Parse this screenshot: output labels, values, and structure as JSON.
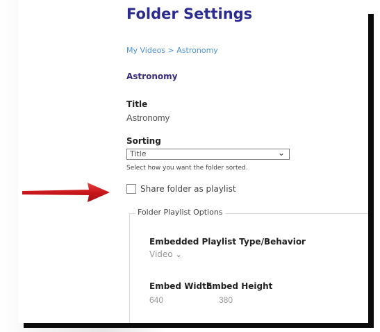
{
  "page": {
    "title": "Folder Settings",
    "breadcrumb": {
      "root": "My Videos",
      "separator": " > ",
      "current": "Astronomy"
    },
    "folder_name": "Astronomy"
  },
  "form": {
    "title_label": "Title",
    "title_value": "Astronomy",
    "sorting_label": "Sorting",
    "sorting_value": "Title",
    "sorting_hint": "Select how you want the folder sorted.",
    "share_checkbox_label": "Share folder as playlist",
    "share_checked": false
  },
  "playlist_options": {
    "legend": "Folder Playlist Options",
    "type_label": "Embedded Playlist Type/Behavior",
    "type_value": "Video",
    "width_label": "Embed Width",
    "height_label": "Embed Height",
    "width_value": "640",
    "height_value": "380"
  },
  "colors": {
    "title": "#2b2b8f",
    "link": "#4a90d9",
    "arrow": "#d0191c"
  },
  "icons": {
    "select_chevron": "chevron-down-icon",
    "annotation": "red-arrow-icon"
  }
}
